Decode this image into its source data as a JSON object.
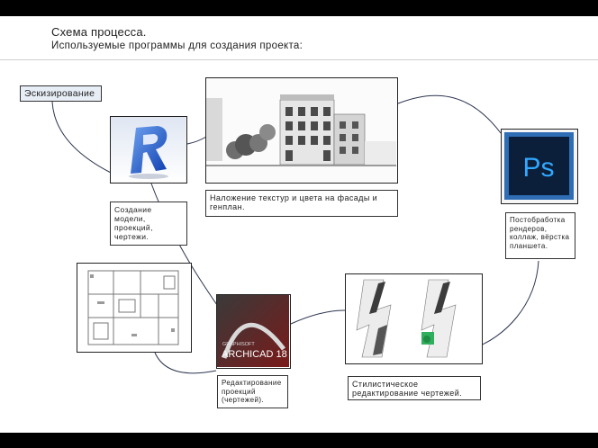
{
  "header": {
    "title": "Схема процесса.",
    "subtitle": "Используемые программы для создания проекта:"
  },
  "stages": {
    "sketch": "Эскизирование",
    "revit_caption": "Создание модели, проекций, чертежи.",
    "facade_caption": "Наложение текстур и цвета на фасады и генплан.",
    "photoshop_caption": "Постобработка рендеров, коллаж, вёрстка планшета.",
    "archicad_caption": "Редактирование проекций (чертежей).",
    "stylistic_caption": "Стилистическое редактирование чертежей."
  },
  "logos": {
    "photoshop_mark": "Ps",
    "archicad_brand": "GRAPHISOFT",
    "archicad_name": "ARCHICAD 18"
  },
  "colors": {
    "revit_blue": "#1f5fd0",
    "photoshop_bg": "#0b1f3a",
    "photoshop_accent": "#31a8ff",
    "archicad_red": "#7a1a1a",
    "sketch_fill": "#e8eef6"
  },
  "icons": [
    "revit-logo-icon",
    "photoshop-logo-icon",
    "archicad-logo-icon"
  ]
}
